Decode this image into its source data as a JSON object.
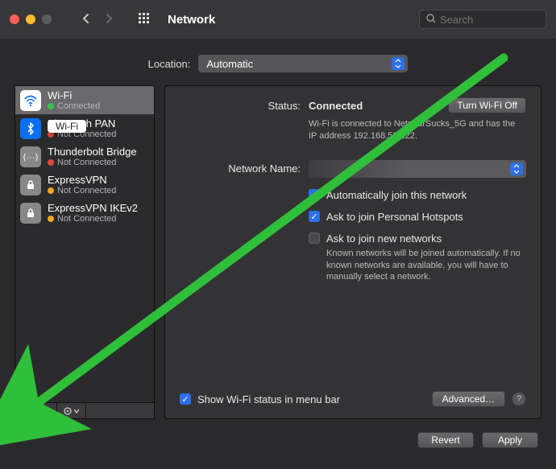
{
  "window": {
    "title": "Network",
    "search_placeholder": "Search"
  },
  "location": {
    "label": "Location:",
    "value": "Automatic"
  },
  "sidebar": {
    "services": [
      {
        "name": "Wi-Fi",
        "status": "Connected",
        "dot": "green",
        "icon": "wifi",
        "selected": true
      },
      {
        "name": "Bluetooth PAN",
        "status": "Not Connected",
        "dot": "red",
        "icon": "bt"
      },
      {
        "name": "Thunderbolt Bridge",
        "status": "Not Connected",
        "dot": "red",
        "icon": "tb"
      },
      {
        "name": "ExpressVPN",
        "status": "Not Connected",
        "dot": "orange",
        "icon": "vpn"
      },
      {
        "name": "ExpressVPN IKEv2",
        "status": "Not Connected",
        "dot": "orange",
        "icon": "vpn"
      }
    ],
    "tooltip": "Wi-Fi",
    "add": "+",
    "remove": "−",
    "action": "⊙⌄"
  },
  "details": {
    "status_label": "Status:",
    "status_value": "Connected",
    "toggle_button": "Turn Wi-Fi Off",
    "status_desc": "Wi-Fi is connected to NetgearSucks_5G and has the IP address 192.168.50.222.",
    "network_name_label": "Network Name:",
    "network_name_value": "",
    "auto_join": "Automatically join this network",
    "ask_hotspot": "Ask to join Personal Hotspots",
    "ask_new": "Ask to join new networks",
    "ask_new_desc": "Known networks will be joined automatically. If no known networks are available, you will have to manually select a network.",
    "show_menu": "Show Wi-Fi status in menu bar",
    "advanced": "Advanced…",
    "help": "?"
  },
  "footer": {
    "revert": "Revert",
    "apply": "Apply"
  }
}
